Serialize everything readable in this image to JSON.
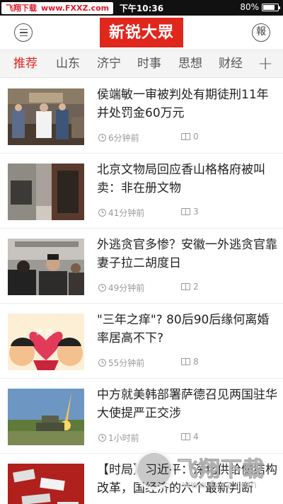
{
  "status_bar": {
    "watermark_left": "飞翔下载",
    "watermark_url": "www.FXXZ.com",
    "time": "下午10:36",
    "battery": "80%",
    "battery_level": 0.8
  },
  "header": {
    "logo": "新锐大眾",
    "paper_icon_text": "報"
  },
  "tabs": [
    {
      "label": "推荐"
    },
    {
      "label": "山东"
    },
    {
      "label": "济宁"
    },
    {
      "label": "时事"
    },
    {
      "label": "思想"
    },
    {
      "label": "财经"
    }
  ],
  "tab_add": "+",
  "news": [
    {
      "title": "侯端敏一审被判处有期徒刑11年并处罚金60万元",
      "time": "6分钟前",
      "comments": "0"
    },
    {
      "title": "北京文物局回应香山格格府被叫卖：非在册文物",
      "time": "41分钟前",
      "comments": "3"
    },
    {
      "title": "外逃贪官多惨？安徽一外逃贪官靠妻子拉二胡度日",
      "time": "49分钟前",
      "comments": "2"
    },
    {
      "title": "\"三年之痒\"? 80后90后缘何离婚率居高不下?",
      "time": "55分钟前",
      "comments": "8"
    },
    {
      "title": "中方就美韩部署萨德召见两国驻华大使提严正交涉",
      "time": "1小时前",
      "comments": "4"
    },
    {
      "title": "【时局】习近平：深化供给侧结构改革，国经济的六个最新判断",
      "time": "",
      "comments": ""
    }
  ],
  "watermark_bottom": {
    "big": "飞翔下载",
    "small": "www.fxxz.com"
  },
  "colors": {
    "accent": "#e1261c",
    "status_bar": "#111111"
  }
}
